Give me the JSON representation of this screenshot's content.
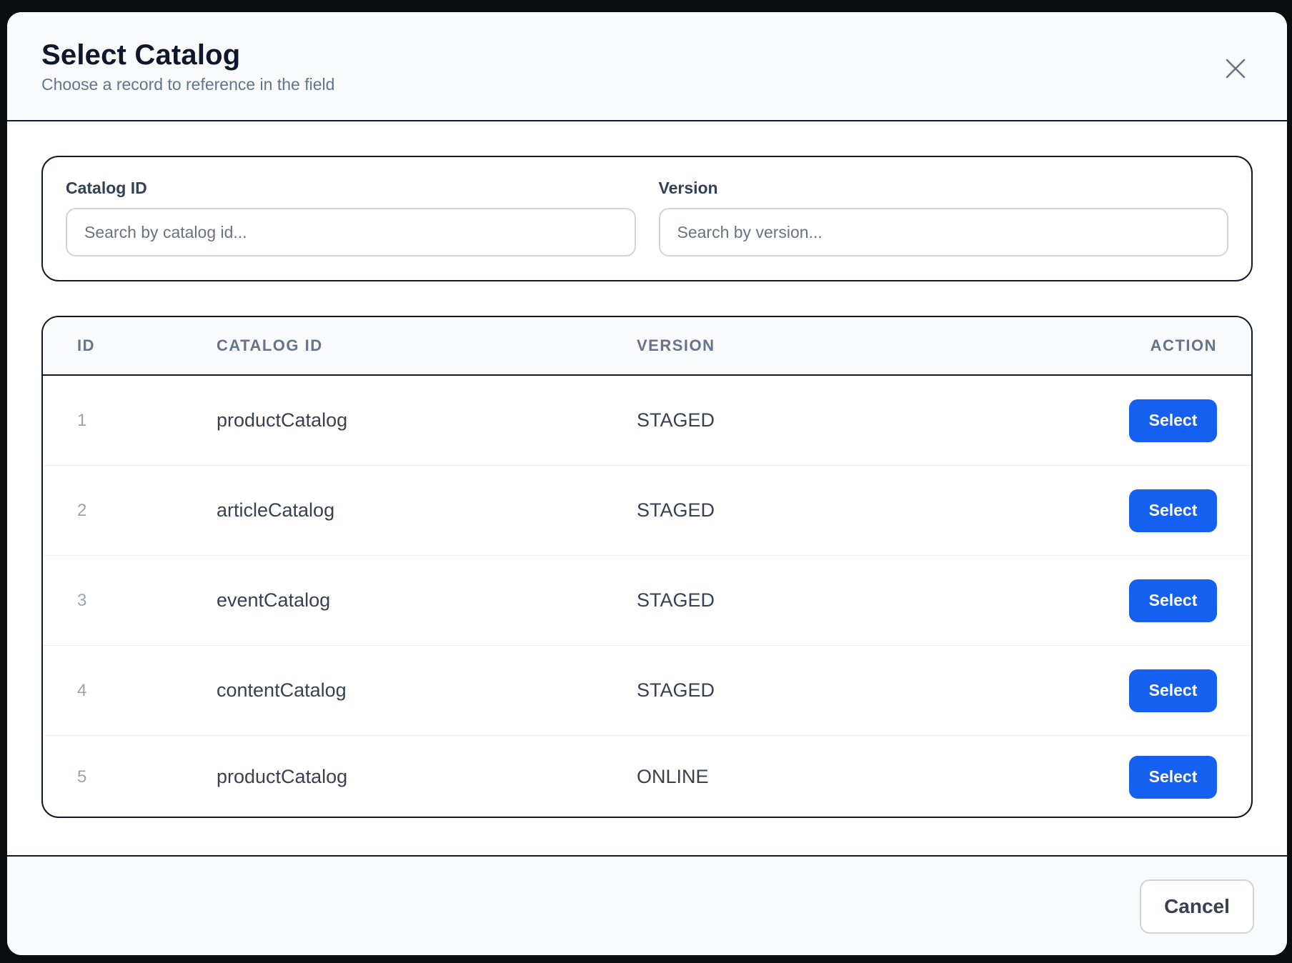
{
  "dialog": {
    "title": "Select Catalog",
    "subtitle": "Choose a record to reference in the field",
    "close_icon": "close-icon"
  },
  "filters": {
    "catalog_id": {
      "label": "Catalog ID",
      "placeholder": "Search by catalog id...",
      "value": ""
    },
    "version": {
      "label": "Version",
      "placeholder": "Search by version...",
      "value": ""
    }
  },
  "table": {
    "headers": {
      "id": "ID",
      "catalog_id": "CATALOG ID",
      "version": "VERSION",
      "action": "ACTION"
    },
    "rows": [
      {
        "id": "1",
        "catalog_id": "productCatalog",
        "version": "STAGED",
        "action": "Select"
      },
      {
        "id": "2",
        "catalog_id": "articleCatalog",
        "version": "STAGED",
        "action": "Select"
      },
      {
        "id": "3",
        "catalog_id": "eventCatalog",
        "version": "STAGED",
        "action": "Select"
      },
      {
        "id": "4",
        "catalog_id": "contentCatalog",
        "version": "STAGED",
        "action": "Select"
      },
      {
        "id": "5",
        "catalog_id": "productCatalog",
        "version": "ONLINE",
        "action": "Select"
      }
    ]
  },
  "footer": {
    "cancel_label": "Cancel"
  },
  "colors": {
    "primary": "#1560f0",
    "border": "#111827",
    "header_bg": "#f8fafc"
  }
}
